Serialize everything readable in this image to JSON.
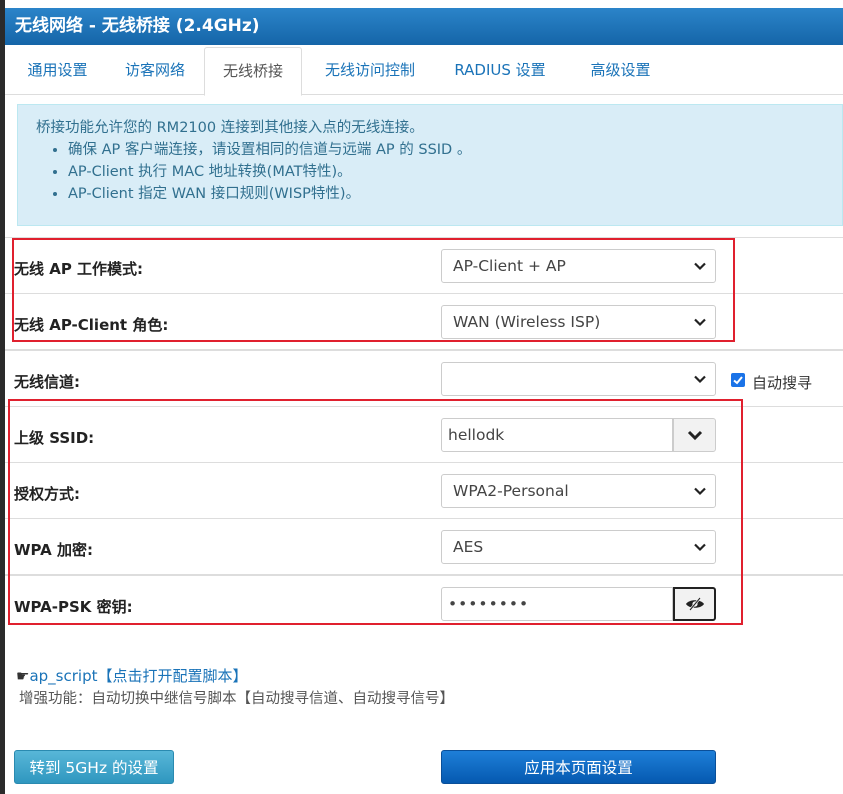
{
  "window_title": "无线网络 - 无线桥接 (2.4GHz)",
  "tabs": [
    {
      "label": "通用设置"
    },
    {
      "label": "访客网络"
    },
    {
      "label": "无线桥接"
    },
    {
      "label": "无线访问控制"
    },
    {
      "label": "RADIUS 设置"
    },
    {
      "label": "高级设置"
    }
  ],
  "info": {
    "intro": "桥接功能允许您的 RM2100 连接到其他接入点的无线连接。",
    "bullets": [
      "确保 AP 客户端连接，请设置相同的信道与远端 AP 的 SSID 。",
      "AP-Client 执行 MAC 地址转换(MAT特性)。",
      "AP-Client 指定 WAN 接口规则(WISP特性)。"
    ]
  },
  "form": {
    "ap_mode": {
      "label": "无线 AP 工作模式:",
      "value": "AP-Client + AP"
    },
    "client_role": {
      "label": "无线 AP-Client 角色:",
      "value": "WAN (Wireless ISP)"
    },
    "channel": {
      "label": "无线信道:",
      "value": "",
      "auto_label": "自动搜寻",
      "auto_checked": true
    },
    "ssid": {
      "label": "上级 SSID:",
      "value": "hellodk"
    },
    "auth": {
      "label": "授权方式:",
      "value": "WPA2-Personal"
    },
    "wpa_enc": {
      "label": "WPA 加密:",
      "value": "AES"
    },
    "psk": {
      "label": "WPA-PSK 密钥:",
      "value": "••••••••"
    }
  },
  "script_link": {
    "prefix": "ap_script",
    "link_text": "【点击打开配置脚本】"
  },
  "enhance_note": "增强功能：自动切换中继信号脚本【自动搜寻信道、自动搜寻信号】",
  "buttons": {
    "to_5g": "转到 5GHz 的设置",
    "apply": "应用本页面设置"
  },
  "colors": {
    "title_bar": "#1d6fb5",
    "accent": "#1a73b8",
    "highlight_box": "#e0202e",
    "apply_button": "#0a64c2",
    "to_5g_button": "#3fa6c9"
  }
}
